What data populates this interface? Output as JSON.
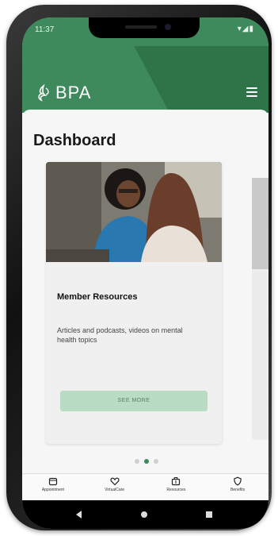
{
  "status_bar": {
    "time": "11:37",
    "indicators": "▾◢▮"
  },
  "header": {
    "logo_text": "BPA",
    "menu_icon": "hamburger-icon"
  },
  "page": {
    "title": "Dashboard"
  },
  "card": {
    "title": "Member Resources",
    "description": "Articles and podcasts, videos on mental health topics",
    "button_label": "SEE MORE"
  },
  "pager": {
    "count": 3,
    "active_index": 1
  },
  "tabbar": {
    "items": [
      {
        "label": "Appointment",
        "icon": "calendar-icon"
      },
      {
        "label": "VirtualCare",
        "icon": "heart-icon"
      },
      {
        "label": "Resources",
        "icon": "briefcase-icon"
      },
      {
        "label": "Benefits",
        "icon": "shield-icon"
      }
    ]
  },
  "colors": {
    "brand": "#3f8a5c",
    "button_bg": "#b8dcc4"
  }
}
